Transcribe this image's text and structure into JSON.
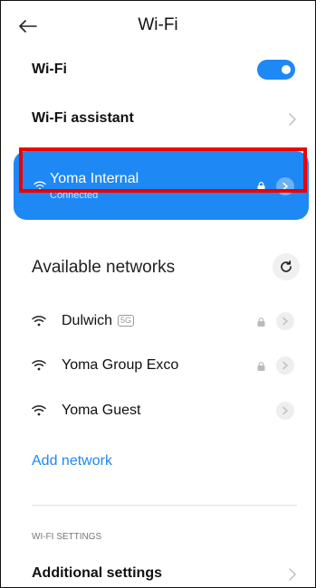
{
  "header": {
    "title": "Wi-Fi"
  },
  "wifi_row": {
    "label": "Wi-Fi",
    "enabled": true
  },
  "assistant_row": {
    "label": "Wi-Fi assistant"
  },
  "connected_network": {
    "name": "Yoma Internal",
    "status": "Connected"
  },
  "available": {
    "title": "Available networks",
    "networks": [
      {
        "name": "Dulwich",
        "badge": "5G",
        "locked": true
      },
      {
        "name": "Yoma Group Exco",
        "badge": "",
        "locked": true
      },
      {
        "name": "Yoma Guest",
        "badge": "",
        "locked": false
      }
    ]
  },
  "add_network": {
    "label": "Add network"
  },
  "settings": {
    "heading": "WI-FI SETTINGS",
    "additional_label": "Additional settings"
  },
  "colors": {
    "accent": "#1e88f5",
    "highlight": "#ee0000"
  }
}
